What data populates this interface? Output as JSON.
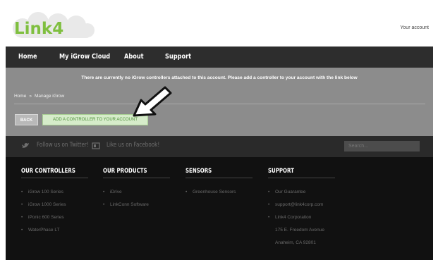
{
  "header": {
    "logo_text": "Link4",
    "account_link": "Your account"
  },
  "nav": {
    "items": [
      "Home",
      "My iGrow Cloud",
      "About",
      "Support"
    ]
  },
  "notice": "There are currently no iGrow controllers attached to this account. Please add a controller to your account with the link below",
  "breadcrumb": {
    "items": [
      "Home",
      "Manage iGrow"
    ],
    "separator": "»"
  },
  "buttons": {
    "back": "BACK",
    "add_controller": "ADD A CONTROLLER TO YOUR ACCOUNT"
  },
  "social": {
    "twitter": "Follow us on Twitter!",
    "facebook": "Like us on Facebook!",
    "search_placeholder": "Search..."
  },
  "footer": {
    "columns": [
      {
        "title": "OUR CONTROLLERS",
        "items": [
          "iGrow 100 Series",
          "iGrow 1000 Series",
          "iPonic 600 Series",
          "WaterPhase LT"
        ]
      },
      {
        "title": "OUR PRODUCTS",
        "items": [
          "iDrive",
          "LinkConn Software"
        ]
      },
      {
        "title": "SENSORS",
        "items": [
          "Greenhouse Sensors"
        ]
      },
      {
        "title": "SUPPORT",
        "items": [
          "Our Guarantee",
          "support@link4corp.com",
          "Link4 Corporation"
        ],
        "address": [
          "175 E. Freedom Avenue",
          "Anaheim, CA 92801"
        ]
      }
    ]
  },
  "colors": {
    "nav_bg": "#2d2d2d",
    "content_bg": "#8c8c8c",
    "footer_bg": "#111111",
    "logo_green": "#7fbf3f",
    "add_button_bg": "#d6ecca"
  },
  "icons": [
    "cloud-logo-icon",
    "twitter-bird-icon",
    "facebook-icon",
    "arrow-pointer-icon"
  ]
}
